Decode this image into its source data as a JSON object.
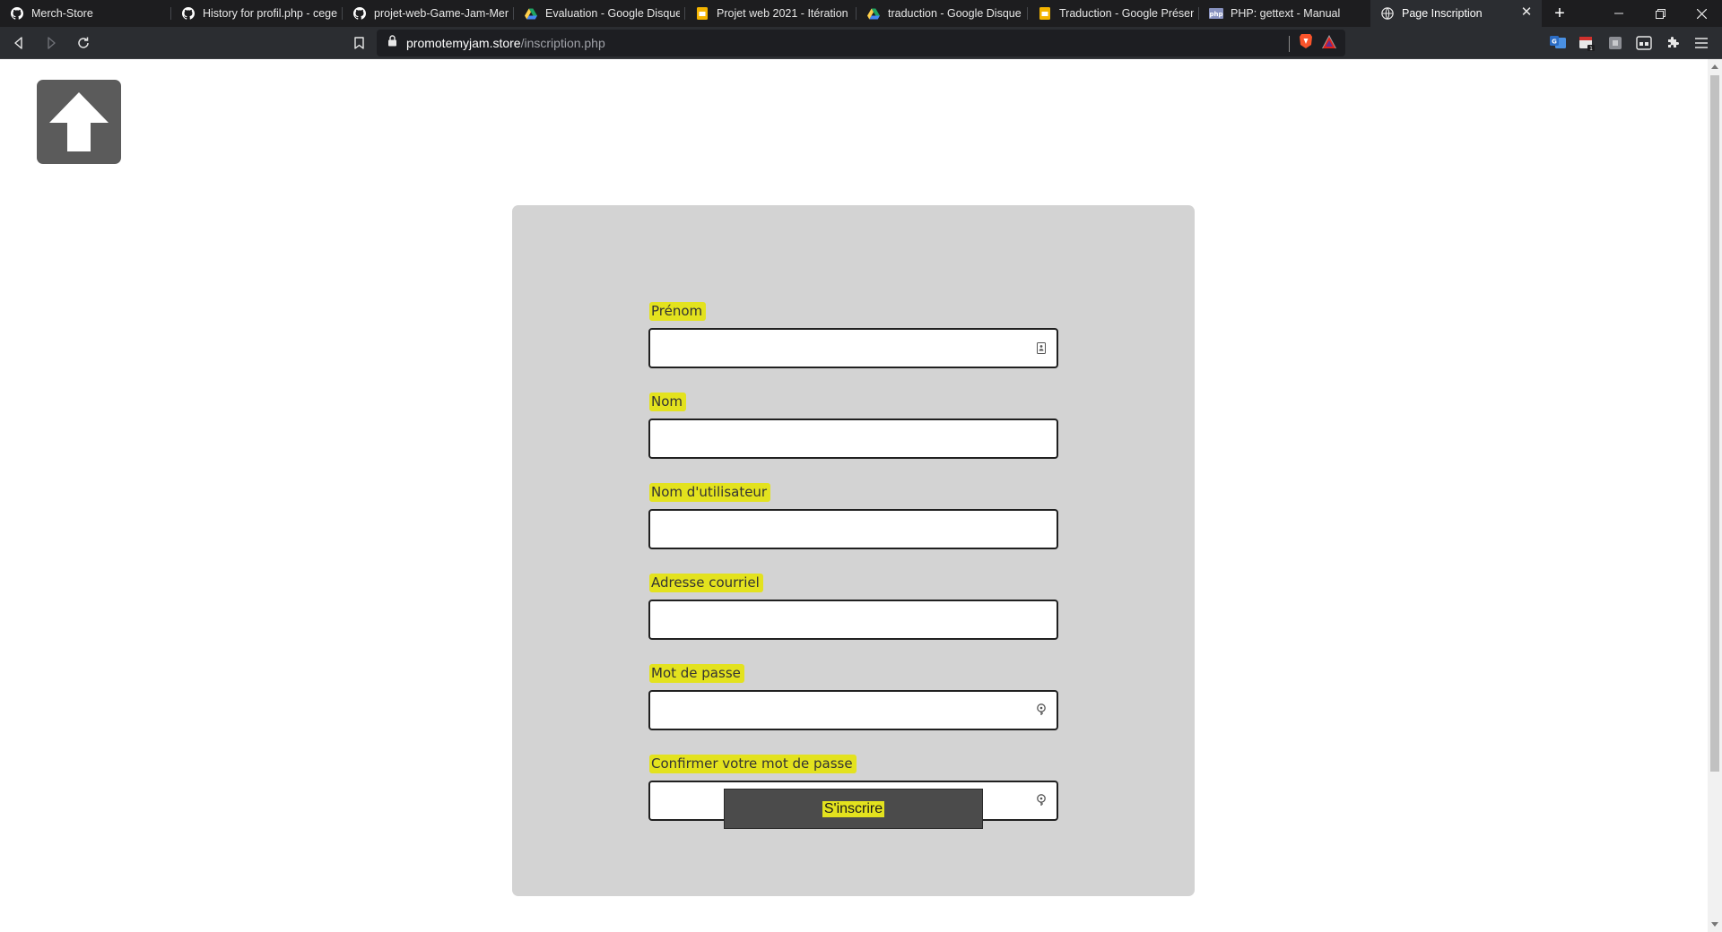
{
  "browser": {
    "tabs": [
      {
        "label": "Merch-Store",
        "icon": "github-icon"
      },
      {
        "label": "History for profil.php - cegep",
        "icon": "github-icon"
      },
      {
        "label": "projet-web-Game-Jam-Merc",
        "icon": "github-icon"
      },
      {
        "label": "Evaluation - Google Disque",
        "icon": "google-drive-icon"
      },
      {
        "label": "Projet web 2021 - Itération 3",
        "icon": "google-slides-icon"
      },
      {
        "label": "traduction - Google Disque",
        "icon": "google-drive-icon"
      },
      {
        "label": "Traduction - Google Présenta",
        "icon": "google-slides-icon"
      },
      {
        "label": "PHP: gettext - Manual",
        "icon": "php-icon"
      },
      {
        "label": "Page Inscription",
        "icon": "globe-icon",
        "active": true
      }
    ],
    "url": {
      "host": "promotemyjam.store",
      "path": "/inscription.php"
    }
  },
  "form": {
    "fields": [
      {
        "label": "Prénom",
        "value": "",
        "icon": "contact-card-icon"
      },
      {
        "label": "Nom",
        "value": ""
      },
      {
        "label": "Nom d'utilisateur",
        "value": ""
      },
      {
        "label": "Adresse courriel",
        "value": ""
      },
      {
        "label": "Mot de passe",
        "value": "",
        "icon": "key-icon"
      },
      {
        "label": "Confirmer votre mot de passe",
        "value": "",
        "icon": "key-icon"
      }
    ],
    "submit_label": "S'inscrire"
  },
  "colors": {
    "highlight": "#e3e21e",
    "card_bg": "#d3d3d3",
    "button_bg": "#4b4b4b",
    "logo_bg": "#5b5b5b"
  }
}
